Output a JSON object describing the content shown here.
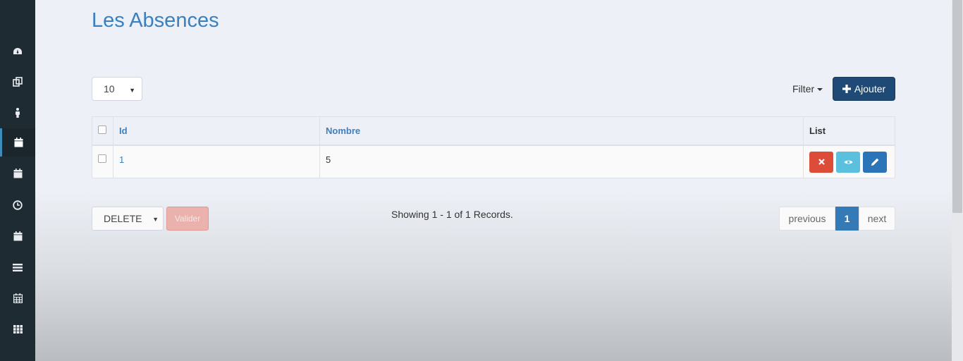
{
  "page": {
    "title": "Les Absences"
  },
  "sidebar": {
    "items": [
      {
        "icon": "dashboard-icon"
      },
      {
        "icon": "copy-icon"
      },
      {
        "icon": "person-icon"
      },
      {
        "icon": "calendar-icon",
        "active": true
      },
      {
        "icon": "calendar-icon"
      },
      {
        "icon": "clock-icon"
      },
      {
        "icon": "calendar-icon"
      },
      {
        "icon": "list-icon"
      },
      {
        "icon": "calendar-grid-icon"
      },
      {
        "icon": "grid-icon"
      }
    ]
  },
  "toolbar": {
    "page_size": "10",
    "filter_label": "Filter",
    "add_label": "Ajouter"
  },
  "table": {
    "columns": {
      "id": "Id",
      "nombre": "Nombre",
      "list": "List"
    },
    "rows": [
      {
        "id": "1",
        "nombre": "5"
      }
    ]
  },
  "footer": {
    "bulk_action": "DELETE",
    "validate_label": "Valider",
    "records_text": "Showing 1 - 1 of 1 Records.",
    "pagination": {
      "previous": "previous",
      "current": "1",
      "next": "next"
    }
  },
  "colors": {
    "title": "#3a80c0",
    "sidebar": "#1f2b33",
    "add_button": "#1e4a75",
    "delete": "#dd4b39",
    "view": "#5bc0de",
    "edit": "#2b74b8",
    "page_active": "#337ab7"
  }
}
